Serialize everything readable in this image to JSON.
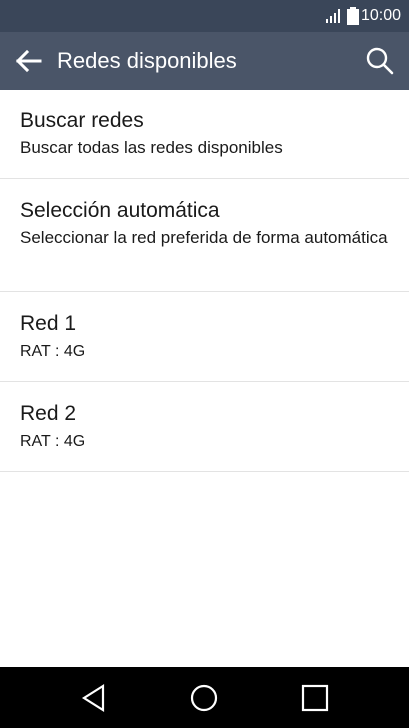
{
  "status_bar": {
    "time": "10:00",
    "icons": [
      "signal-icon",
      "battery-icon"
    ]
  },
  "app_bar": {
    "title": "Redes disponibles",
    "back_icon": "arrow-left-icon",
    "search_icon": "search-icon"
  },
  "list": {
    "items": [
      {
        "title": "Buscar redes",
        "subtitle": "Buscar todas las redes disponibles"
      },
      {
        "title": "Selección automática",
        "subtitle": "Seleccionar la red preferida de forma automática"
      },
      {
        "title": "Red 1",
        "subtitle": "RAT : 4G"
      },
      {
        "title": "Red 2",
        "subtitle": "RAT : 4G"
      }
    ]
  },
  "nav_bar": {
    "icons": [
      "back-triangle-icon",
      "home-circle-icon",
      "recents-square-icon"
    ]
  },
  "colors": {
    "status_bar": "#3a4659",
    "app_bar": "#4a5568",
    "background": "#ffffff",
    "nav_bar": "#000000",
    "divider": "#e3e3e3"
  }
}
